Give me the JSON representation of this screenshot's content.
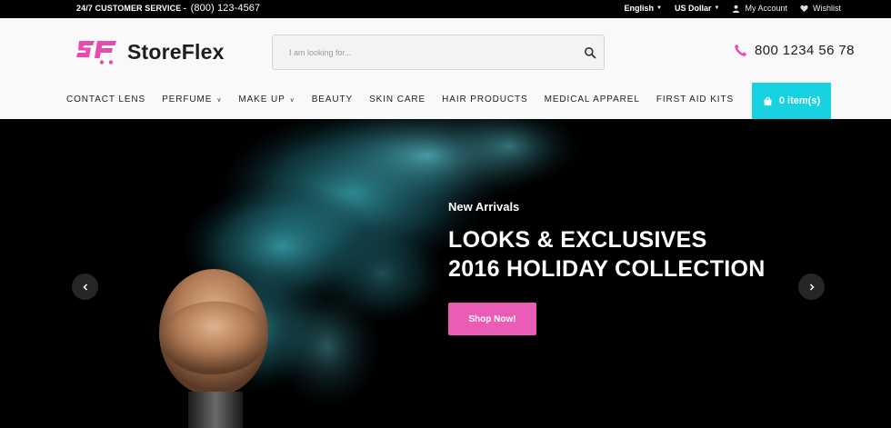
{
  "topbar": {
    "service_label": "24/7 CUSTOMER SERVICE -",
    "service_phone": "(800) 123-4567",
    "language": "English",
    "currency": "US Dollar",
    "account": "My Account",
    "wishlist": "Wishlist"
  },
  "header": {
    "logo_text": "StoreFlex",
    "search_placeholder": "I am looking for...",
    "phone": "800 1234 56 78"
  },
  "nav": {
    "items": [
      {
        "label": "CONTACT LENS"
      },
      {
        "label": "PERFUME"
      },
      {
        "label": "MAKE UP"
      },
      {
        "label": "BEAUTY"
      },
      {
        "label": "SKIN CARE"
      },
      {
        "label": "HAIR PRODUCTS"
      },
      {
        "label": "MEDICAL APPAREL"
      },
      {
        "label": "FIRST AID KITS"
      }
    ],
    "cart_label": "0 item(s)"
  },
  "hero": {
    "kicker": "New Arrivals",
    "title_line1": "LOOKS & EXCLUSIVES",
    "title_line2": "2016 HOLIDAY COLLECTION",
    "cta": "Shop Now!"
  },
  "colors": {
    "accent_pink": "#ea5cb6",
    "accent_cyan": "#17d3e2",
    "dark": "#000000"
  },
  "icons": {
    "search": "search-icon",
    "phone": "phone-icon",
    "cart": "shopping-bag-icon",
    "account": "user-icon",
    "wishlist": "heart-icon",
    "prev": "chevron-left-icon",
    "next": "chevron-right-icon"
  }
}
